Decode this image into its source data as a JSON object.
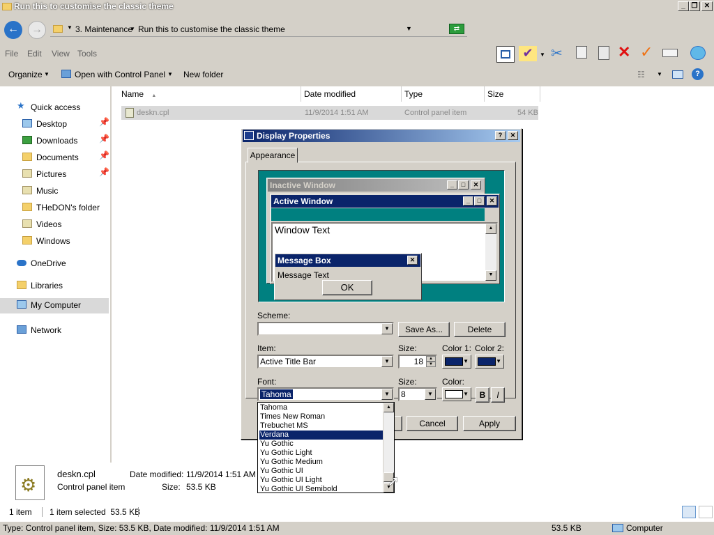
{
  "explorer": {
    "title": "Run this to customise the classic theme",
    "address": {
      "crumb1": "3. Maintenance",
      "crumb2": "Run this to customise the classic theme"
    },
    "menu": [
      "File",
      "Edit",
      "View",
      "Tools"
    ],
    "commands": {
      "organize": "Organize",
      "open_with": "Open with Control Panel",
      "new_folder": "New folder"
    },
    "nav": {
      "quick_access": "Quick access",
      "desktop": "Desktop",
      "downloads": "Downloads",
      "documents": "Documents",
      "pictures": "Pictures",
      "music": "Music",
      "thedon": "THeDON's folder",
      "videos": "Videos",
      "windows": "Windows",
      "onedrive": "OneDrive",
      "libraries": "Libraries",
      "my_computer": "My Computer",
      "network": "Network"
    },
    "columns": {
      "name": "Name",
      "date": "Date modified",
      "type": "Type",
      "size": "Size"
    },
    "file": {
      "name": "deskn.cpl",
      "date": "11/9/2014 1:51 AM",
      "type": "Control panel item",
      "size": "54 KB"
    },
    "details": {
      "name": "deskn.cpl",
      "type": "Control panel item",
      "date_label": "Date modified:",
      "date_value": "11/9/2014 1:51 AM",
      "size_label": "Size:",
      "size_value": "53.5 KB"
    },
    "status": {
      "count": "1 item",
      "selected": "1 item selected  53.5 KB"
    },
    "statusbar": {
      "info": "Type: Control panel item, Size: 53.5 KB, Date modified: 11/9/2014 1:51 AM",
      "size": "53.5 KB",
      "location": "Computer"
    }
  },
  "dialog": {
    "title": "Display Properties",
    "tab": "Appearance",
    "preview": {
      "inactive": "Inactive Window",
      "active": "Active Window",
      "window_text": "Window Text",
      "msgbox_title": "Message Box",
      "msgbox_text": "Message Text",
      "ok": "OK"
    },
    "scheme_label": "Scheme:",
    "scheme_value": "",
    "save_as": "Save As...",
    "delete": "Delete",
    "item_label": "Item:",
    "item_value": "Active Title Bar",
    "size_label": "Size:",
    "size_value": "18",
    "color1_label": "Color 1:",
    "color2_label": "Color 2:",
    "font_label": "Font:",
    "font_value": "Tahoma",
    "font_size_label": "Size:",
    "font_size_value": "8",
    "color_label": "Color:",
    "bold": "B",
    "italic": "I",
    "cancel": "Cancel",
    "apply": "Apply",
    "font_options": [
      "Tahoma",
      "Times New Roman",
      "Trebuchet MS",
      "Verdana",
      "Yu Gothic",
      "Yu Gothic Light",
      "Yu Gothic Medium",
      "Yu Gothic UI",
      "Yu Gothic UI Light",
      "Yu Gothic UI Semibold"
    ],
    "highlighted_font": "Verdana",
    "colors": {
      "title_bar": "#0a246a",
      "preview_bg": "#008080",
      "inactive_bar": "#808080",
      "color_white": "#ffffff"
    }
  }
}
